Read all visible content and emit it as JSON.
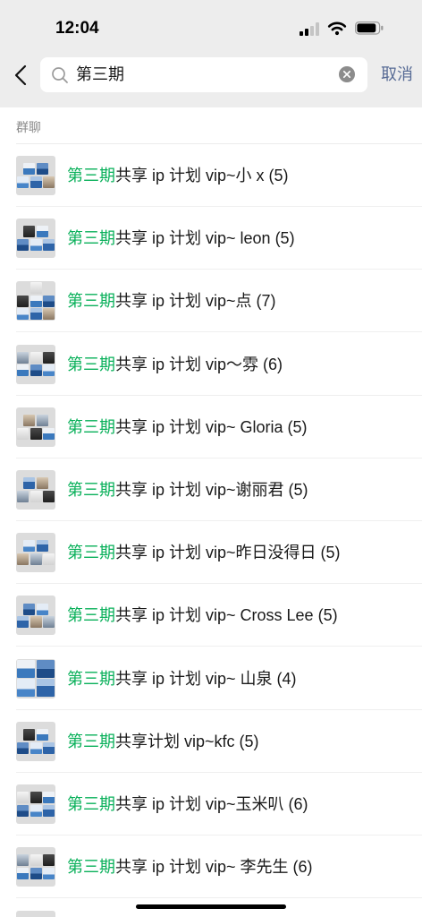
{
  "status_bar": {
    "time": "12:04",
    "signal_icon": "cellular-signal-icon",
    "signal_bars": 2,
    "signal_max": 4,
    "wifi_icon": "wifi-icon",
    "battery_icon": "battery-icon",
    "battery_level": 0.9
  },
  "search": {
    "back_icon": "chevron-left-icon",
    "search_icon": "search-icon",
    "query": "第三期",
    "clear_icon": "clear-circle-icon",
    "cancel_label": "取消"
  },
  "section": {
    "title": "群聊"
  },
  "results": [
    {
      "highlight": "第三期",
      "rest": "共享 ip 计划 vip~小 x (5)"
    },
    {
      "highlight": "第三期",
      "rest": "共享 ip 计划 vip~ leon (5)"
    },
    {
      "highlight": "第三期",
      "rest": "共享 ip 计划 vip~点 (7)"
    },
    {
      "highlight": "第三期",
      "rest": "共享 ip 计划 vip～雰 (6)"
    },
    {
      "highlight": "第三期",
      "rest": "共享 ip 计划 vip~ Gloria (5)"
    },
    {
      "highlight": "第三期",
      "rest": "共享 ip 计划 vip~谢丽君 (5)"
    },
    {
      "highlight": "第三期",
      "rest": "共享 ip 计划 vip~昨日没得日 (5)"
    },
    {
      "highlight": "第三期",
      "rest": "共享 ip 计划 vip~ Cross Lee (5)"
    },
    {
      "highlight": "第三期",
      "rest": "共享 ip 计划 vip~ 山泉 (4)"
    },
    {
      "highlight": "第三期",
      "rest": "共享计划 vip~kfc (5)"
    },
    {
      "highlight": "第三期",
      "rest": "共享 ip 计划 vip~玉米叭 (6)"
    },
    {
      "highlight": "第三期",
      "rest": "共享 ip 计划 vip~ 李先生 (6)"
    }
  ],
  "colors": {
    "top_background": "#ededed",
    "highlight": "#09b05a",
    "cancel": "#576b95",
    "home_indicator": "#000000"
  }
}
